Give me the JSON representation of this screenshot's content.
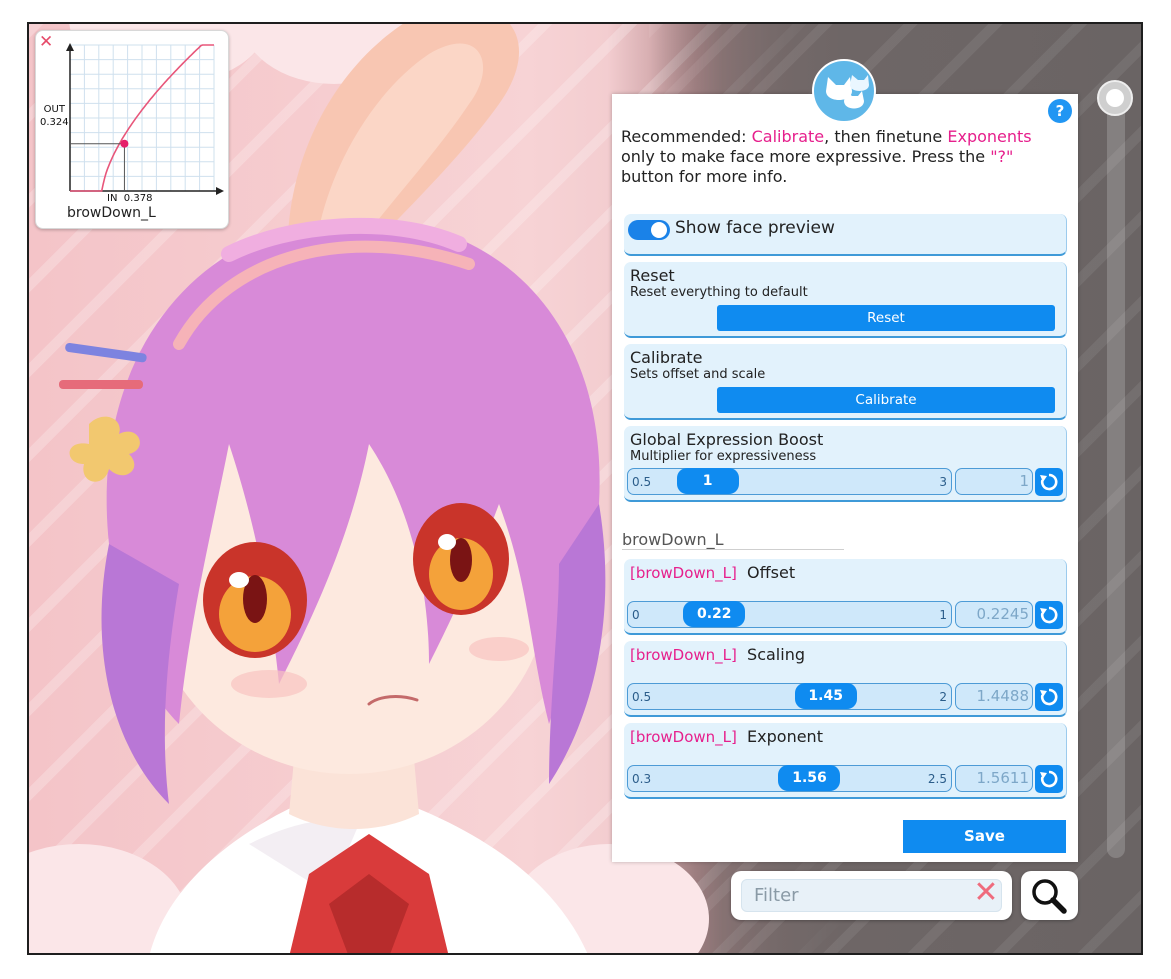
{
  "curve_preview": {
    "close_icon": "close-x-icon",
    "blendshape": "browDown_L",
    "out_label": "OUT",
    "out_value": "0.324",
    "in_label": "IN",
    "in_value": "0.378",
    "x_marker": 0.378,
    "y_marker": 0.324
  },
  "panel": {
    "logo_icon": "cats-logo-icon",
    "help_label": "?",
    "intro": {
      "part1": "Recommended: ",
      "calibrate": "Calibrate",
      "part2": ", then finetune ",
      "exponents": "Exponents",
      "part3": " only to make face more expressive. Press the ",
      "question": "\"?\"",
      "part4": " button for more info."
    },
    "show_face_preview": {
      "label": "Show face preview",
      "checked": true
    },
    "reset": {
      "title": "Reset",
      "subtitle": "Reset everything to default",
      "button": "Reset"
    },
    "calibrate": {
      "title": "Calibrate",
      "subtitle": "Sets offset and scale",
      "button": "Calibrate"
    },
    "global_boost": {
      "title": "Global Expression Boost",
      "subtitle": "Multiplier for expressiveness",
      "min": "0.5",
      "max": "3",
      "value": 1,
      "thumb_label": "1",
      "field": "1"
    },
    "section_label": "browDown_L",
    "offset": {
      "tag": "[browDown_L]",
      "title": "Offset",
      "min": "0",
      "max": "1",
      "value": 0.2245,
      "thumb_label": "0.22",
      "field": "0.2245"
    },
    "scaling": {
      "tag": "[browDown_L]",
      "title": "Scaling",
      "min": "0.5",
      "max": "2",
      "value": 1.4488,
      "thumb_label": "1.45",
      "field": "1.4488"
    },
    "exponent": {
      "tag": "[browDown_L]",
      "title": "Exponent",
      "min": "0.3",
      "max": "2.5",
      "value": 1.5611,
      "thumb_label": "1.56",
      "field": "1.5611"
    },
    "save_button": "Save"
  },
  "filter": {
    "placeholder": "Filter",
    "value": "",
    "clear_icon": "clear-x-icon",
    "search_icon": "magnifier-icon"
  },
  "colors": {
    "accent": "#0f8bf0",
    "highlight": "#e61f8c",
    "card_bg": "#e2f2fc"
  }
}
